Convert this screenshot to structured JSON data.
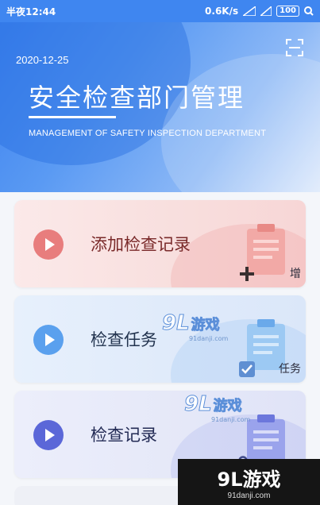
{
  "status_bar": {
    "time": "半夜12:44",
    "network_speed": "0.6K/s",
    "battery": "100"
  },
  "header": {
    "date": "2020-12-25",
    "title": "安全检查部门管理",
    "subtitle": "MANAGEMENT OF SAFETY INSPECTION DEPARTMENT",
    "scan_icon": "scan-frame-icon"
  },
  "cards": [
    {
      "label": "添加检查记录",
      "tag": "增",
      "color": "#e87d7d",
      "icon": "clipboard-add-icon"
    },
    {
      "label": "检查任务",
      "tag": "任务",
      "color": "#5aa0ee",
      "icon": "clipboard-check-icon"
    },
    {
      "label": "检查记录",
      "tag": "",
      "color": "#5b67d8",
      "icon": "clipboard-wrench-icon"
    }
  ],
  "watermark": {
    "number": "9L",
    "text": "游戏",
    "site": "91danji.com"
  }
}
